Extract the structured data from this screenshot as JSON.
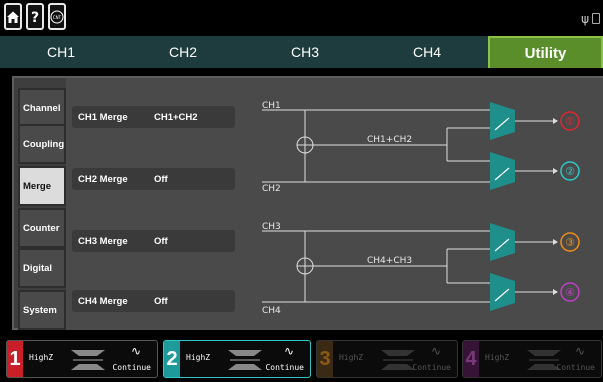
{
  "topbar": {
    "home_icon": "home-icon",
    "help_icon": "help-icon",
    "cnt_icon": "counter-icon",
    "cnt_label": "CNT",
    "usb_icon": "usb-icon"
  },
  "tabs": [
    {
      "label": "CH1"
    },
    {
      "label": "CH2"
    },
    {
      "label": "CH3"
    },
    {
      "label": "CH4"
    },
    {
      "label": "Utility"
    }
  ],
  "sidebar": [
    {
      "label": "Channel"
    },
    {
      "label": "Coupling"
    },
    {
      "label": "Merge"
    },
    {
      "label": "Counter"
    },
    {
      "label": "Digital"
    },
    {
      "label": "System"
    }
  ],
  "merge": [
    {
      "label": "CH1 Merge",
      "value": "CH1+CH2"
    },
    {
      "label": "CH2 Merge",
      "value": "Off"
    },
    {
      "label": "CH3 Merge",
      "value": "Off"
    },
    {
      "label": "CH4 Merge",
      "value": "Off"
    }
  ],
  "diagram": {
    "in_top_1": "CH1",
    "in_bot_1": "CH2",
    "sum_1": "CH1+CH2",
    "in_top_2": "CH3",
    "in_bot_2": "CH4",
    "sum_2": "CH4+CH3",
    "out_1": "①",
    "out_2": "②",
    "out_3": "③",
    "out_4": "④",
    "colors": {
      "out_1": "#e0262f",
      "out_2": "#2ec8c8",
      "out_3": "#f08c1a",
      "out_4": "#c040c8",
      "switch": "#1f8f8c"
    }
  },
  "channels": [
    {
      "num": "1",
      "impedance": "HighZ",
      "mode": "Continue",
      "wave": "∿",
      "color": "#e0262f",
      "active": true
    },
    {
      "num": "2",
      "impedance": "HighZ",
      "mode": "Continue",
      "wave": "∿",
      "color": "#2ec8c8",
      "active": true
    },
    {
      "num": "3",
      "impedance": "HighZ",
      "mode": "Continue",
      "wave": "∿",
      "color": "#f08c1a",
      "active": false
    },
    {
      "num": "4",
      "impedance": "HighZ",
      "mode": "Continue",
      "wave": "∿",
      "color": "#c040c8",
      "active": false
    }
  ],
  "theme": {
    "accent": "#5a8e2a",
    "tabbar": "#1e3b3d",
    "panel": "#4a4a4a"
  }
}
